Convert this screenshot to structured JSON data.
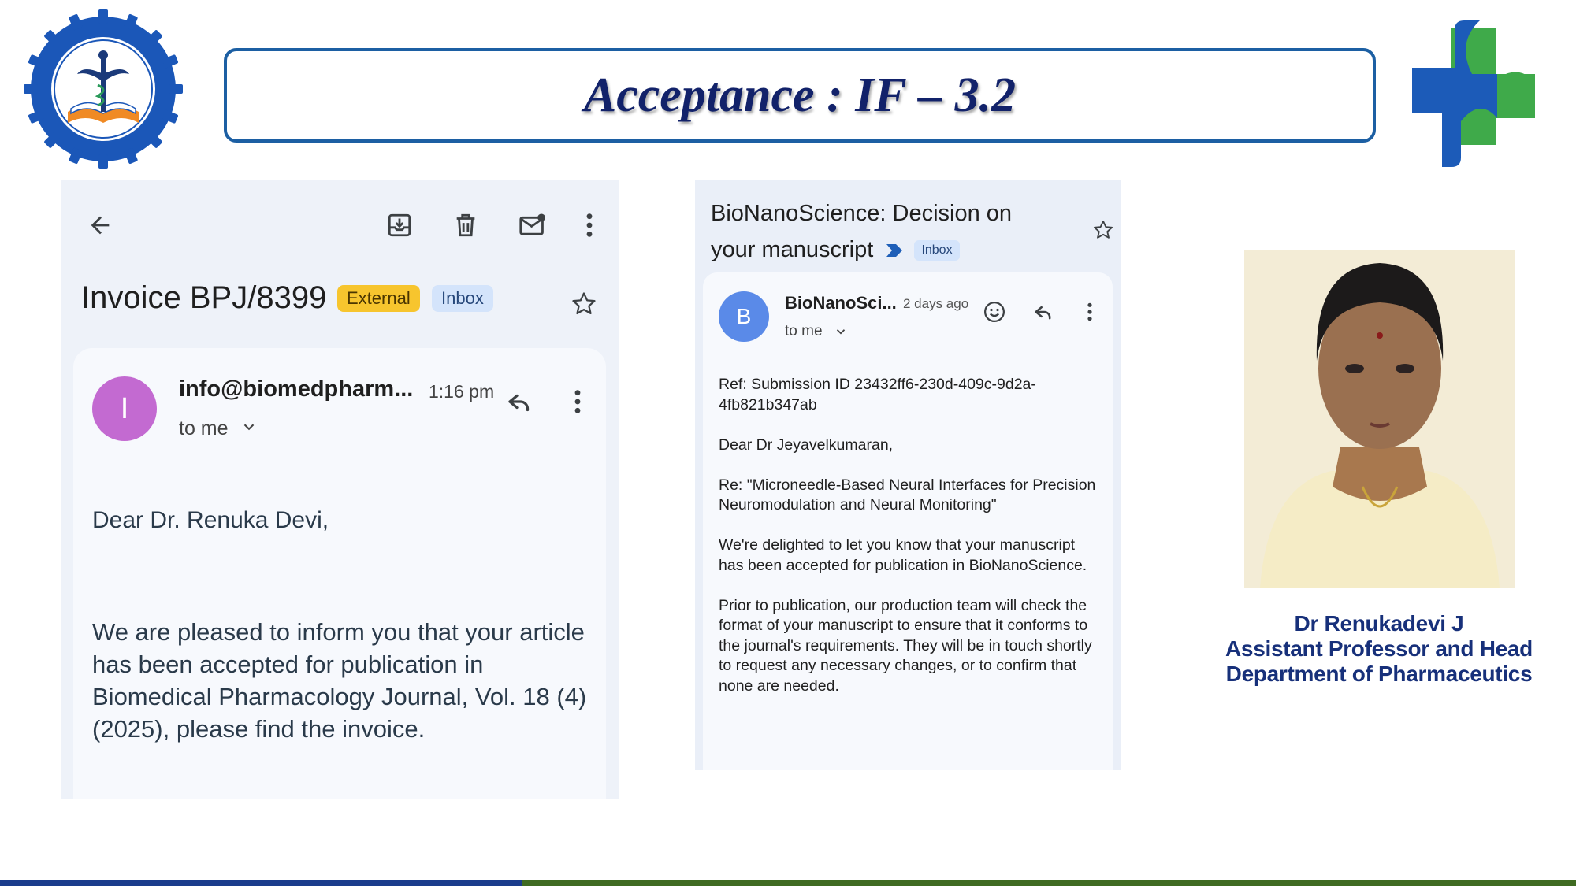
{
  "slide": {
    "title": "Acceptance : IF – 3.2",
    "logo_left_icon": "institute-seal-logo",
    "logo_right_icon": "medical-cross-logo",
    "colors": {
      "title": "#12226a",
      "title_border": "#1c5fa3",
      "bar_blue": "#1a3c8c",
      "bar_green": "#3f6b22"
    }
  },
  "left_email": {
    "toolbar": {
      "back_icon": "arrow-left-icon",
      "archive_icon": "archive-icon",
      "delete_icon": "trash-icon",
      "unread_icon": "mark-unread-icon",
      "more_icon": "more-vert-icon"
    },
    "subject": "Invoice BPJ/8399",
    "badges": [
      "External",
      "Inbox"
    ],
    "star_icon": "star-outline-icon",
    "avatar_letter": "I",
    "sender": "info@biomedpharm...",
    "time": "1:16 pm",
    "to_me": "to me",
    "reply_icon": "reply-icon",
    "greeting": "Dear Dr. Renuka Devi,",
    "body": "We are pleased to inform you that your article has been accepted for publication in Biomedical Pharmacology Journal, Vol. 18 (4) (2025), please find the invoice."
  },
  "mid_email": {
    "subject": "BioNanoScience: Decision on your manuscript",
    "badge": "Inbox",
    "star_icon": "star-outline-icon",
    "avatar_letter": "B",
    "sender": "BioNanoSci...",
    "time": "2 days ago",
    "to_me": "to me",
    "emoji_icon": "emoji-smile-icon",
    "reply_icon": "reply-icon",
    "more_icon": "more-vert-icon",
    "paragraphs": [
      "Ref: Submission ID 23432ff6-230d-409c-9d2a-4fb821b347ab",
      "Dear Dr Jeyavelkumaran,",
      "Re: \"Microneedle-Based Neural Interfaces for Precision Neuromodulation and Neural Monitoring\"",
      "We're delighted to let you know that your manuscript has been accepted for publication in BioNanoScience.",
      "Prior to publication, our production team will check the format of your manuscript to ensure that it conforms to the journal's requirements. They will be in touch shortly to request any necessary changes, or to confirm that none are needed."
    ]
  },
  "profile": {
    "photo_icon": "portrait-photo",
    "name": "Dr Renukadevi J",
    "role": "Assistant Professor and Head",
    "department": "Department of Pharmaceutics"
  }
}
